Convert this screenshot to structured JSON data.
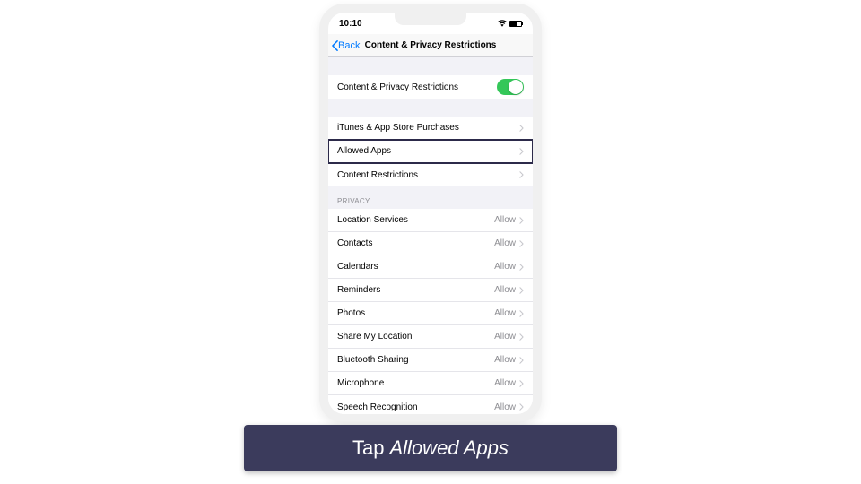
{
  "status": {
    "time": "10:10"
  },
  "nav": {
    "back": "Back",
    "title": "Content & Privacy Restrictions"
  },
  "main_toggle": {
    "label": "Content & Privacy Restrictions",
    "on": true
  },
  "group1": [
    {
      "label": "iTunes & App Store Purchases"
    },
    {
      "label": "Allowed Apps",
      "highlighted": true
    },
    {
      "label": "Content Restrictions"
    }
  ],
  "privacy_header": "Privacy",
  "privacy": [
    {
      "label": "Location Services",
      "value": "Allow"
    },
    {
      "label": "Contacts",
      "value": "Allow"
    },
    {
      "label": "Calendars",
      "value": "Allow"
    },
    {
      "label": "Reminders",
      "value": "Allow"
    },
    {
      "label": "Photos",
      "value": "Allow"
    },
    {
      "label": "Share My Location",
      "value": "Allow"
    },
    {
      "label": "Bluetooth Sharing",
      "value": "Allow"
    },
    {
      "label": "Microphone",
      "value": "Allow"
    },
    {
      "label": "Speech Recognition",
      "value": "Allow"
    }
  ],
  "caption": {
    "prefix": "Tap ",
    "emph": "Allowed Apps"
  }
}
